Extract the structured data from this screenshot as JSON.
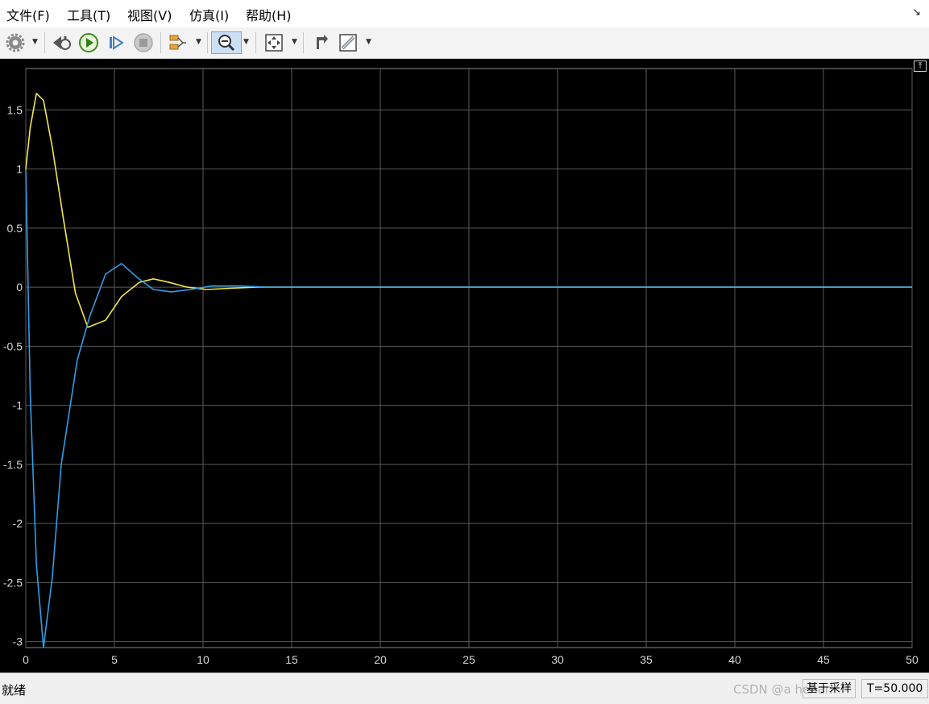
{
  "menu": {
    "items": [
      "文件(F)",
      "工具(T)",
      "视图(V)",
      "仿真(I)",
      "帮助(H)"
    ]
  },
  "toolbar": {
    "buttons": [
      {
        "name": "settings-icon",
        "dropdown": true
      },
      {
        "name": "step-back-icon",
        "dropdown": false
      },
      {
        "name": "run-icon",
        "dropdown": false
      },
      {
        "name": "step-forward-icon",
        "dropdown": false
      },
      {
        "name": "stop-icon",
        "dropdown": false
      },
      {
        "name": "highlight-icon",
        "dropdown": true
      },
      {
        "name": "zoom-icon",
        "dropdown": true,
        "active": true
      },
      {
        "name": "fit-view-icon",
        "dropdown": true
      },
      {
        "name": "restore-icon",
        "dropdown": false
      },
      {
        "name": "measure-icon",
        "dropdown": true
      }
    ]
  },
  "status": {
    "text": "就绪",
    "mode": "基于采样",
    "time": "T=50.000",
    "watermark": "CSDN @a       henan"
  },
  "colors": {
    "plot_background": "#000000",
    "grid": "#5a5a5a",
    "axis_text": "#d8d8d8",
    "series_yellow": "#f2e84a",
    "series_blue": "#2f9ee8"
  },
  "chart_data": {
    "type": "line",
    "xlim": [
      0,
      50
    ],
    "ylim": [
      -3.05,
      1.85
    ],
    "x_ticks": [
      0,
      5,
      10,
      15,
      20,
      25,
      30,
      35,
      40,
      45,
      50
    ],
    "y_ticks": [
      -3,
      -2.5,
      -2,
      -1.5,
      -1,
      -0.5,
      0,
      0.5,
      1,
      1.5
    ],
    "x_tick_labels": [
      "0",
      "5",
      "10",
      "15",
      "20",
      "25",
      "30",
      "35",
      "40",
      "45",
      "50"
    ],
    "y_tick_labels": [
      "-3",
      "-2.5",
      "-2",
      "-1.5",
      "-1",
      "-0.5",
      "0",
      "0.5",
      "1",
      "1.5"
    ],
    "grid": true,
    "series": [
      {
        "color": "#f2e84a",
        "x": [
          0,
          0.25,
          0.6,
          1.0,
          1.5,
          2.1,
          2.8,
          3.5,
          4.5,
          5.4,
          6.4,
          7.2,
          8.1,
          9.1,
          10.2,
          11.5,
          13,
          15,
          20,
          30,
          50
        ],
        "y": [
          1.0,
          1.35,
          1.64,
          1.58,
          1.18,
          0.6,
          -0.05,
          -0.34,
          -0.28,
          -0.08,
          0.04,
          0.07,
          0.04,
          0.0,
          -0.02,
          -0.01,
          0.0,
          0.0,
          0.0,
          0.0,
          0.0
        ]
      },
      {
        "color": "#2f9ee8",
        "x": [
          0,
          0.25,
          0.6,
          1.0,
          1.5,
          2.0,
          2.9,
          3.6,
          4.5,
          5.4,
          6.3,
          7.2,
          8.2,
          9.3,
          10.5,
          12,
          13.5,
          15,
          20,
          30,
          50
        ],
        "y": [
          1.0,
          -0.9,
          -2.35,
          -3.05,
          -2.45,
          -1.5,
          -0.62,
          -0.25,
          0.11,
          0.2,
          0.08,
          -0.02,
          -0.04,
          -0.02,
          0.01,
          0.01,
          0.0,
          0.0,
          0.0,
          0.0,
          0.0
        ]
      }
    ]
  }
}
